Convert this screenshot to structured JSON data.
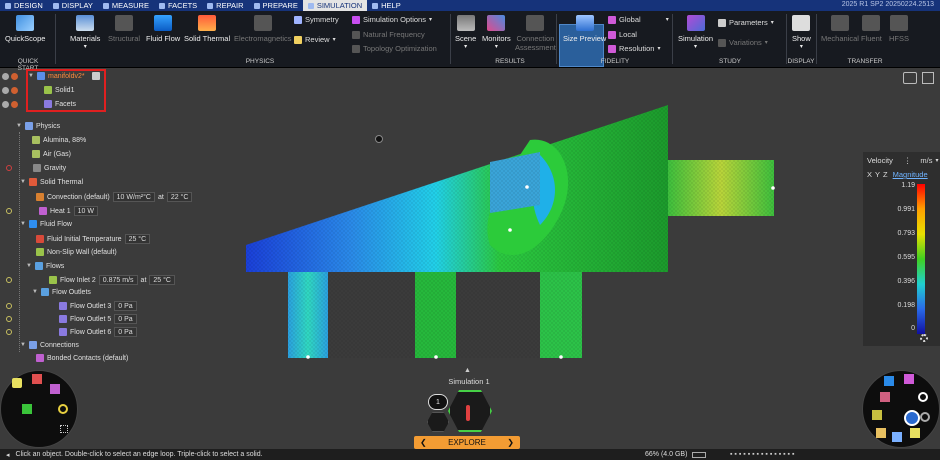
{
  "tabs": [
    {
      "label": "Design"
    },
    {
      "label": "Display"
    },
    {
      "label": "Measure"
    },
    {
      "label": "Facets"
    },
    {
      "label": "Repair"
    },
    {
      "label": "Prepare"
    },
    {
      "label": "Simulation"
    },
    {
      "label": "Help"
    }
  ],
  "active_tab": "Simulation",
  "version": "2025 R1 SP2 20250224.2513",
  "ribbon": {
    "quickscope": "QuickScope",
    "materials": "Materials",
    "structural": "Structural",
    "fluid_flow": "Fluid Flow",
    "solid_thermal": "Solid Thermal",
    "electromagnetics": "Electromagnetics",
    "symmetry": "Symmetry",
    "review": "Review",
    "sim_options": "Simulation Options",
    "nat_freq": "Natural Frequency",
    "topo_opt": "Topology Optimization",
    "scene": "Scene",
    "monitors": "Monitors",
    "conn_assess_1": "Connection",
    "conn_assess_2": "Assessment",
    "size_preview": "Size Preview",
    "global": "Global",
    "local": "Local",
    "resolution": "Resolution",
    "simulation": "Simulation",
    "parameters": "Parameters",
    "variations": "Variations",
    "show": "Show",
    "mechanical": "Mechanical",
    "fluent": "Fluent",
    "hfss": "HFSS",
    "groups": {
      "quick_start": "Quick Start",
      "physics": "Physics",
      "results": "Results",
      "fidelity": "Fidelity",
      "study": "Study",
      "display": "Display",
      "transfer": "Transfer"
    }
  },
  "tree": {
    "root": "manifoldv2*",
    "solid": "Solid1",
    "facets": "Facets",
    "physics": "Physics",
    "mat1": "Alumina, 88%",
    "mat2": "Air (Gas)",
    "gravity": "Gravity",
    "solid_thermal": "Solid Thermal",
    "convection": "Convection (default)",
    "convection_val": "10 W/m²°C",
    "at": "at",
    "convection_temp": "22 °C",
    "heat": "Heat 1",
    "heat_val": "10 W",
    "fluid_flow": "Fluid Flow",
    "fluid_init": "Fluid Initial Temperature",
    "fluid_init_val": "25 °C",
    "noslip": "Non-Slip Wall (default)",
    "flows": "Flows",
    "inlet": "Flow Inlet 2",
    "inlet_val": "0.875 m/s",
    "inlet_temp": "25 °C",
    "outlets": "Flow Outlets",
    "outlet3": "Flow Outlet 3",
    "outlet3_val": "0 Pa",
    "outlet5": "Flow Outlet 5",
    "outlet5_val": "0 Pa",
    "outlet6": "Flow Outlet 6",
    "outlet6_val": "0 Pa",
    "connections": "Connections",
    "bonded": "Bonded Contacts (default)"
  },
  "legend": {
    "quantity": "Velocity",
    "unit": "m/s",
    "axes": [
      "X",
      "Y",
      "Z"
    ],
    "mode": "Magnitude",
    "ticks": [
      "1.19",
      "0.991",
      "0.793",
      "0.595",
      "0.396",
      "0.198",
      "0"
    ]
  },
  "sim_label": "Simulation 1",
  "stage_number": "1",
  "explore": "Explore",
  "status": {
    "hint": "Click an object. Double-click to select an edge loop. Triple-click to select a solid.",
    "memory": "66% (4.0 GB)"
  }
}
